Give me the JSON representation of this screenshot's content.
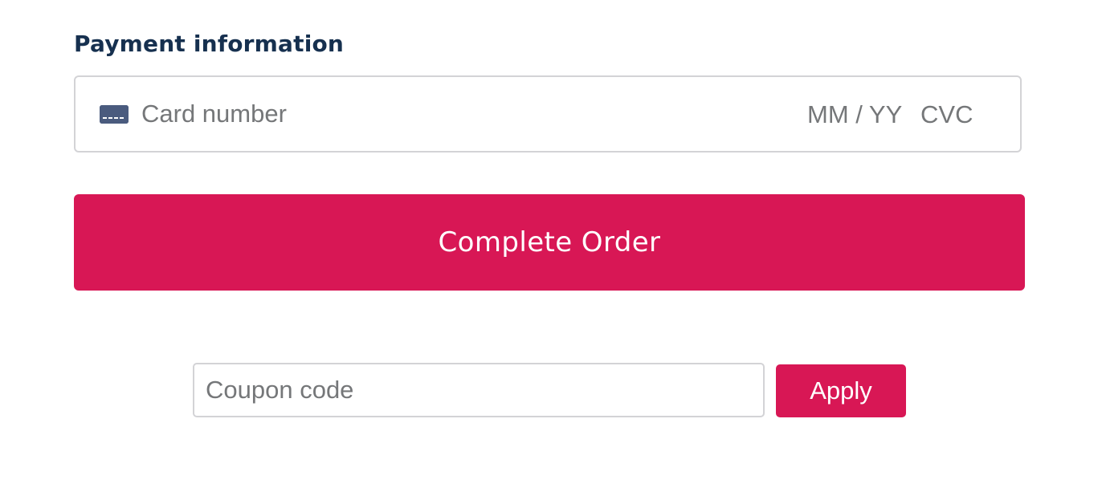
{
  "payment": {
    "title": "Payment information",
    "card_number_placeholder": "Card number",
    "expiry_placeholder": "MM / YY",
    "cvc_placeholder": "CVC",
    "card_icon": "credit-card-icon"
  },
  "order": {
    "complete_label": "Complete Order"
  },
  "coupon": {
    "placeholder": "Coupon code",
    "apply_label": "Apply"
  },
  "colors": {
    "accent": "#d81755",
    "title": "#16304f",
    "placeholder": "#757779",
    "icon": "#4a5b7e",
    "border": "#d3d3d6"
  }
}
